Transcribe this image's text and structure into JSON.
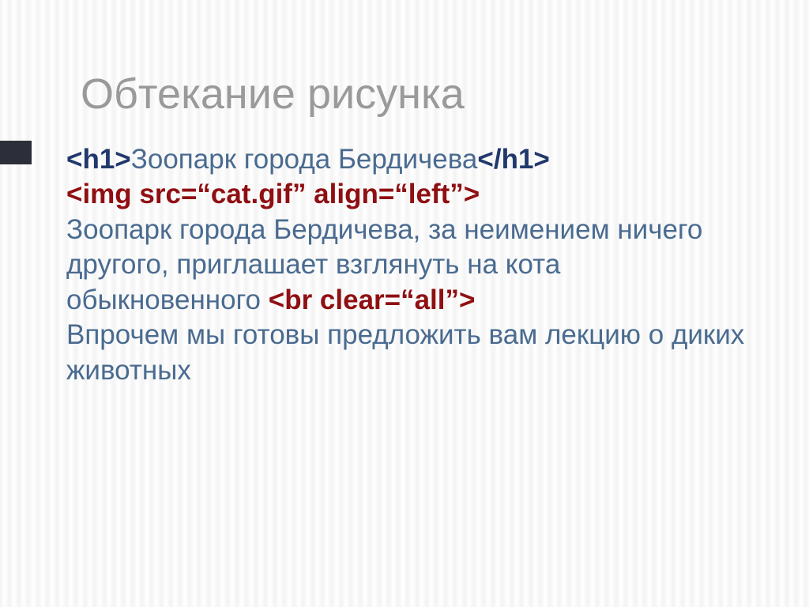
{
  "slide": {
    "title": "Обтекание рисунка",
    "h1_open": "<h1>",
    "h1_text": "Зоопарк города Бердичева",
    "h1_close": "</h1>",
    "img_tag": "<img src=“cat.gif” align=“left”>",
    "body1": "Зоопарк города Бердичева, за неимением ничего другого, приглашает взглянуть на кота обыкновенного ",
    "br_tag": "<br clear=“all”>",
    "body2": "Впрочем мы готовы предложить вам лекцию о диких животных"
  }
}
